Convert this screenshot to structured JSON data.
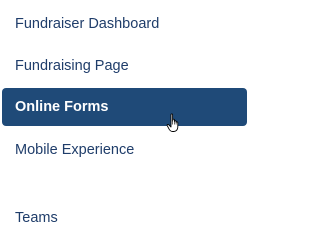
{
  "nav": {
    "items": [
      {
        "label": "Fundraiser Dashboard",
        "active": false
      },
      {
        "label": "Fundraising Page",
        "active": false
      },
      {
        "label": "Online Forms",
        "active": true
      },
      {
        "label": "Mobile Experience",
        "active": false
      },
      {
        "label": "Teams",
        "active": false
      }
    ]
  },
  "colors": {
    "text": "#1f3d6a",
    "active_background": "#1f4a78",
    "active_text": "#ffffff"
  },
  "cursor": {
    "icon": "hand-pointer-icon"
  }
}
